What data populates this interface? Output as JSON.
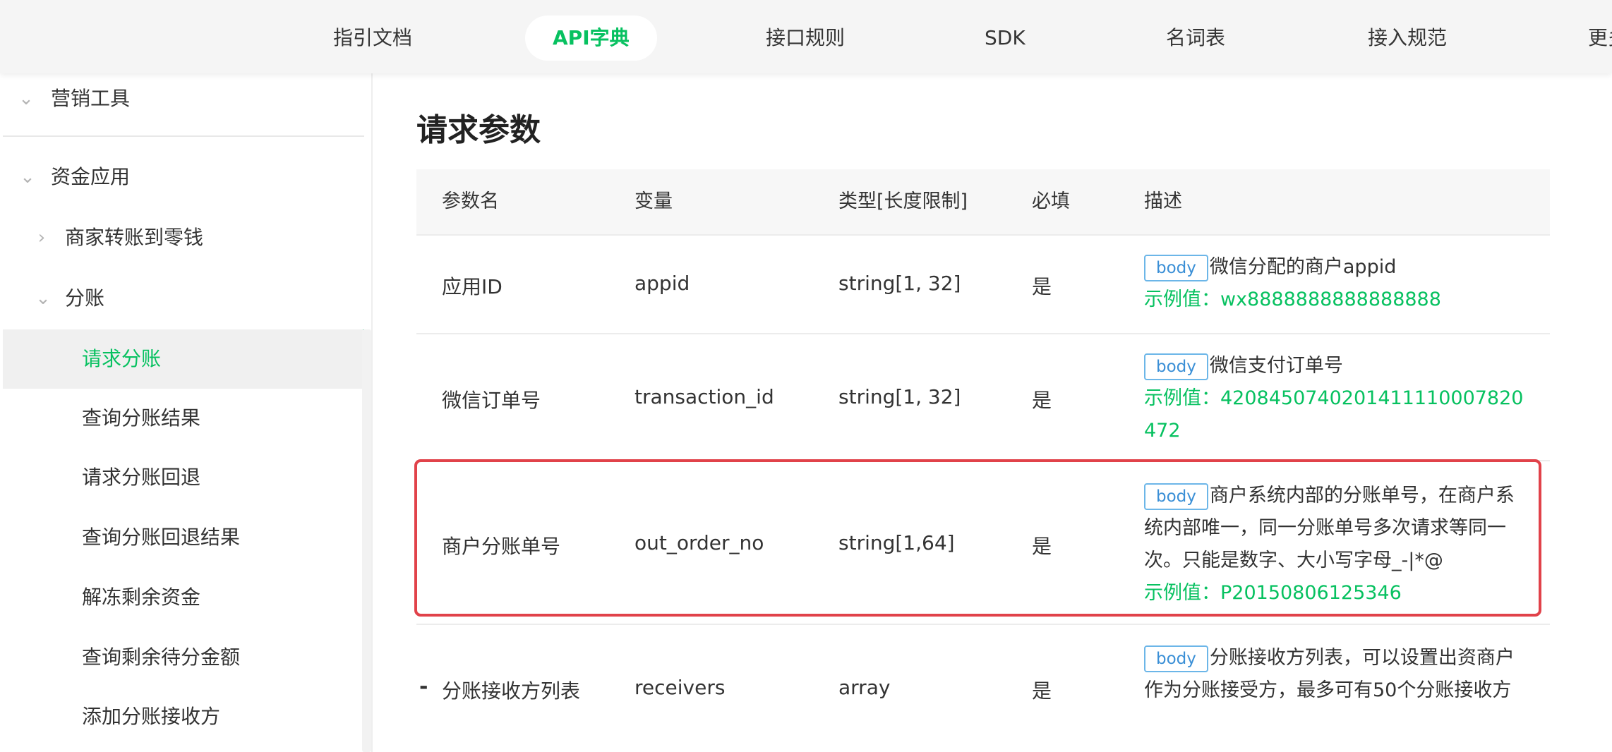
{
  "nav": {
    "items": [
      "指引文档",
      "API字典",
      "接口规则",
      "SDK",
      "名词表",
      "接入规范",
      "更多"
    ],
    "active_index": 1
  },
  "sidebar": {
    "partial_top_label": "营销工具",
    "items": [
      {
        "label": "资金应用",
        "level": 0,
        "expanded": true
      },
      {
        "label": "商家转账到零钱",
        "level": 1,
        "expanded": false
      },
      {
        "label": "分账",
        "level": 1,
        "expanded": true
      },
      {
        "label": "请求分账",
        "level": 2,
        "active": true
      },
      {
        "label": "查询分账结果",
        "level": 2
      },
      {
        "label": "请求分账回退",
        "level": 2
      },
      {
        "label": "查询分账回退结果",
        "level": 2
      },
      {
        "label": "解冻剩余资金",
        "level": 2
      },
      {
        "label": "查询剩余待分金额",
        "level": 2
      },
      {
        "label": "添加分账接收方",
        "level": 2
      }
    ]
  },
  "main": {
    "title": "请求参数",
    "table": {
      "headers": [
        "参数名",
        "变量",
        "类型[长度限制]",
        "必填",
        "描述"
      ],
      "rows": [
        {
          "name": "应用ID",
          "var": "appid",
          "type": "string[1, 32]",
          "required": "是",
          "tag": "body",
          "desc": "微信分配的商户appid",
          "example_label": "示例值：",
          "example_value": "wx8888888888888888"
        },
        {
          "name": "微信订单号",
          "var": "transaction_id",
          "type": "string[1, 32]",
          "required": "是",
          "tag": "body",
          "desc": "微信支付订单号",
          "example_label": "示例值：",
          "example_value": "4208450740201411110007820472"
        },
        {
          "name": "商户分账单号",
          "var": "out_order_no",
          "type": "string[1,64]",
          "required": "是",
          "tag": "body",
          "desc": "商户系统内部的分账单号，在商户系统内部唯一，同一分账单号多次请求等同一次。只能是数字、大小写字母_-|*@",
          "example_label": "示例值：",
          "example_value": "P20150806125346"
        },
        {
          "name": "分账接收方列表",
          "var": "receivers",
          "type": "array",
          "required": "是",
          "tag": "body",
          "desc": "分账接收方列表，可以设置出资商户作为分账接受方，最多可有50个分账接收方",
          "expander": "-"
        }
      ]
    }
  },
  "colors": {
    "accent": "#07c160",
    "highlight_border": "#e1424a",
    "tag_border": "#6cb6e8",
    "tag_text": "#3a8fd6"
  }
}
